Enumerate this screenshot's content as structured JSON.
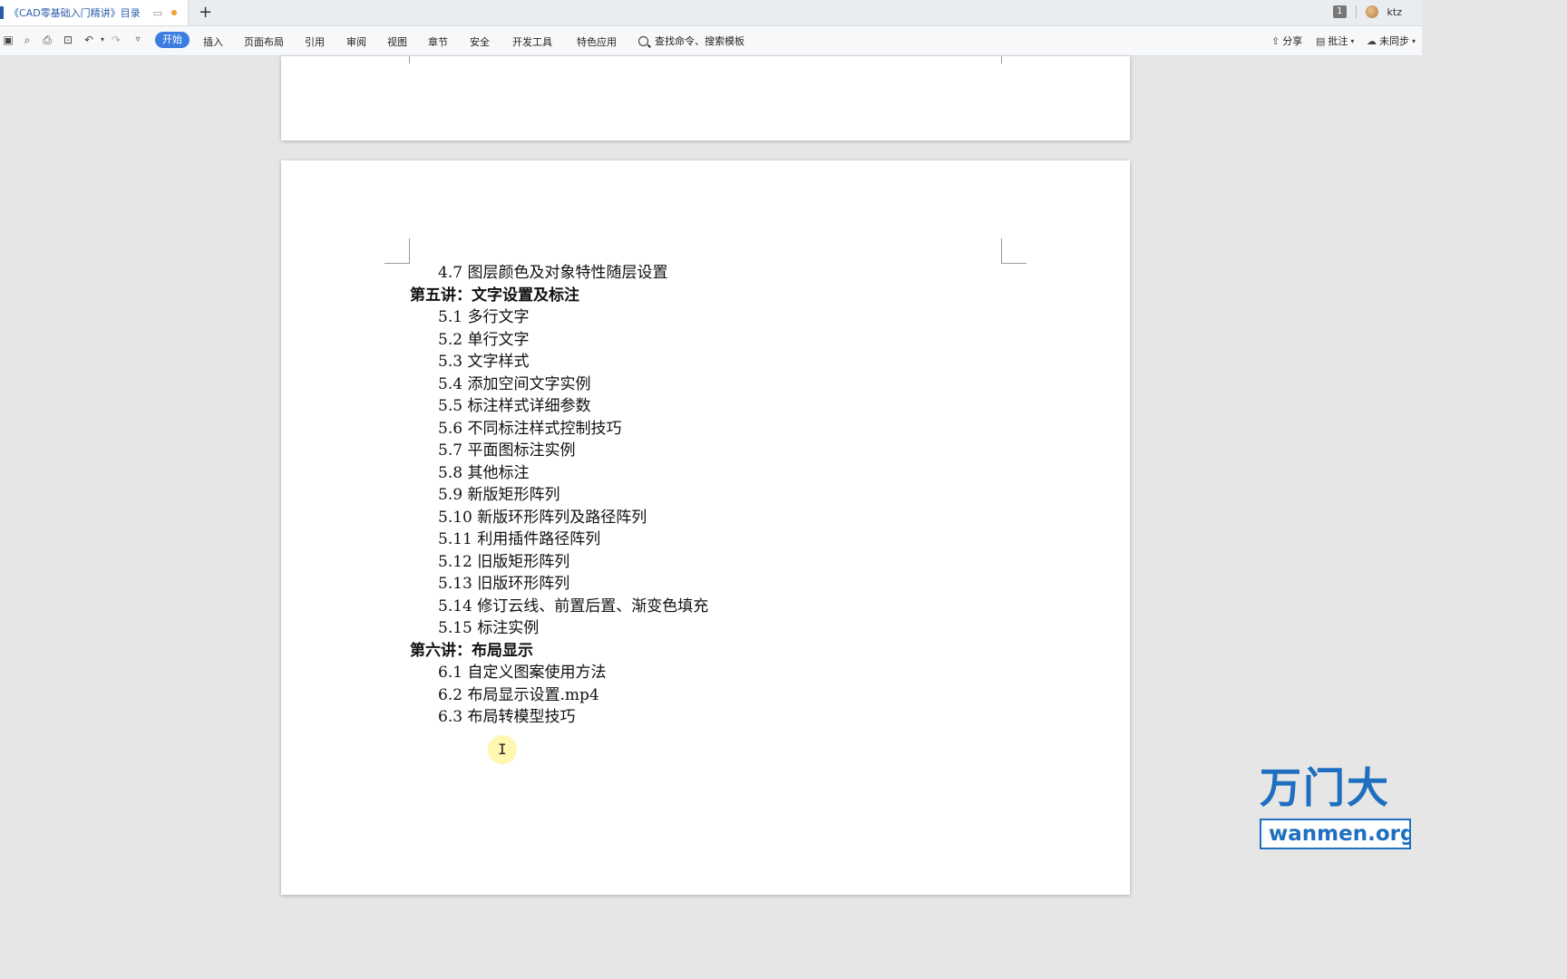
{
  "tab": {
    "title": "《CAD零基础入门精讲》目录",
    "new_tab": "+"
  },
  "window": {
    "page_count_badge": "1",
    "user": "ktz"
  },
  "quick_access": [
    "save-icon",
    "format-painter-icon",
    "print-icon",
    "print-preview-icon",
    "undo-icon",
    "redo-icon",
    "more-icon"
  ],
  "menu": {
    "start": "开始",
    "items": [
      "插入",
      "页面布局",
      "引用",
      "审阅",
      "视图",
      "章节",
      "安全",
      "开发工具",
      "特色应用"
    ],
    "search": "查找命令、搜索模板"
  },
  "right_actions": {
    "share": "分享",
    "comment": "批注",
    "sync": "未同步"
  },
  "toc": [
    {
      "text": "4.7 图层颜色及对象特性随层设置",
      "level": 2
    },
    {
      "text": "第五讲：文字设置及标注",
      "level": 1
    },
    {
      "text": "5.1 多行文字",
      "level": 2
    },
    {
      "text": "5.2 单行文字",
      "level": 2
    },
    {
      "text": "5.3 文字样式",
      "level": 2
    },
    {
      "text": "5.4 添加空间文字实例",
      "level": 2
    },
    {
      "text": "5.5 标注样式详细参数",
      "level": 2
    },
    {
      "text": "5.6 不同标注样式控制技巧",
      "level": 2
    },
    {
      "text": "5.7 平面图标注实例",
      "level": 2
    },
    {
      "text": "5.8 其他标注",
      "level": 2
    },
    {
      "text": "5.9 新版矩形阵列",
      "level": 2
    },
    {
      "text": "5.10 新版环形阵列及路径阵列",
      "level": 2
    },
    {
      "text": "5.11 利用插件路径阵列",
      "level": 2
    },
    {
      "text": "5.12 旧版矩形阵列",
      "level": 2
    },
    {
      "text": "5.13 旧版环形阵列",
      "level": 2
    },
    {
      "text": "5.14 修订云线、前置后置、渐变色填充",
      "level": 2
    },
    {
      "text": "5.15 标注实例",
      "level": 2
    },
    {
      "text": "第六讲：布局显示",
      "level": 1
    },
    {
      "text": "6.1 自定义图案使用方法",
      "level": 2
    },
    {
      "text": "6.2 布局显示设置.mp4",
      "level": 2
    },
    {
      "text": "6.3 布局转模型技巧",
      "level": 2
    }
  ],
  "watermark": {
    "cn": "万门大",
    "en": "wanmen.org"
  },
  "colors": {
    "accent": "#3b7de0",
    "tab_text": "#2a5caa",
    "watermark": "#1f6fc0"
  }
}
